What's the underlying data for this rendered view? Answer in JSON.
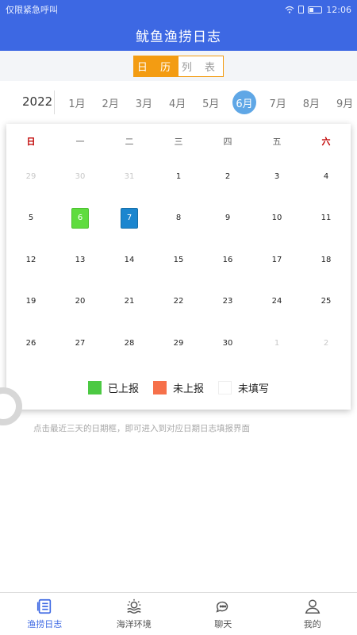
{
  "status_bar": {
    "left_text": "仅限紧急呼叫",
    "time": "12:06"
  },
  "header": {
    "title": "鱿鱼渔捞日志"
  },
  "view_toggle": {
    "calendar_label": "日 历",
    "list_label": "列 表",
    "selected": "calendar"
  },
  "month_bar": {
    "year": "2022",
    "months": [
      "1月",
      "2月",
      "3月",
      "4月",
      "5月",
      "6月",
      "7月",
      "8月",
      "9月"
    ],
    "selected_index": 5
  },
  "calendar": {
    "weekdays": [
      "日",
      "一",
      "二",
      "三",
      "四",
      "五",
      "六"
    ],
    "days": [
      {
        "label": "29",
        "state": "other"
      },
      {
        "label": "30",
        "state": "other"
      },
      {
        "label": "31",
        "state": "other"
      },
      {
        "label": "1",
        "state": "normal"
      },
      {
        "label": "2",
        "state": "normal"
      },
      {
        "label": "3",
        "state": "normal"
      },
      {
        "label": "4",
        "state": "normal"
      },
      {
        "label": "5",
        "state": "normal"
      },
      {
        "label": "6",
        "state": "reported"
      },
      {
        "label": "7",
        "state": "today"
      },
      {
        "label": "8",
        "state": "normal"
      },
      {
        "label": "9",
        "state": "normal"
      },
      {
        "label": "10",
        "state": "normal"
      },
      {
        "label": "11",
        "state": "normal"
      },
      {
        "label": "12",
        "state": "normal"
      },
      {
        "label": "13",
        "state": "normal"
      },
      {
        "label": "14",
        "state": "normal"
      },
      {
        "label": "15",
        "state": "normal"
      },
      {
        "label": "16",
        "state": "normal"
      },
      {
        "label": "17",
        "state": "normal"
      },
      {
        "label": "18",
        "state": "normal"
      },
      {
        "label": "19",
        "state": "normal"
      },
      {
        "label": "20",
        "state": "normal"
      },
      {
        "label": "21",
        "state": "normal"
      },
      {
        "label": "22",
        "state": "normal"
      },
      {
        "label": "23",
        "state": "normal"
      },
      {
        "label": "24",
        "state": "normal"
      },
      {
        "label": "25",
        "state": "normal"
      },
      {
        "label": "26",
        "state": "normal"
      },
      {
        "label": "27",
        "state": "normal"
      },
      {
        "label": "28",
        "state": "normal"
      },
      {
        "label": "29",
        "state": "normal"
      },
      {
        "label": "30",
        "state": "normal"
      },
      {
        "label": "1",
        "state": "other"
      },
      {
        "label": "2",
        "state": "other"
      }
    ]
  },
  "legend": [
    {
      "label": "已上报",
      "color": "#4cc943"
    },
    {
      "label": "未上报",
      "color": "#f6704a"
    },
    {
      "label": "未填写",
      "color": "#ffffff"
    }
  ],
  "hint": "点击最近三天的日期框，即可进入到对应日期日志填报界面",
  "tabbar": [
    {
      "label": "渔捞日志",
      "icon": "list-icon",
      "active": true
    },
    {
      "label": "海洋环境",
      "icon": "sun-waves-icon",
      "active": false
    },
    {
      "label": "聊天",
      "icon": "chat-icon",
      "active": false
    },
    {
      "label": "我的",
      "icon": "person-icon",
      "active": false
    }
  ],
  "colors": {
    "primary": "#3d68e3",
    "accent": "#f39c12",
    "month_selected": "#5fa7e6",
    "reported": "#5fdc3f",
    "today": "#1b86cf"
  }
}
